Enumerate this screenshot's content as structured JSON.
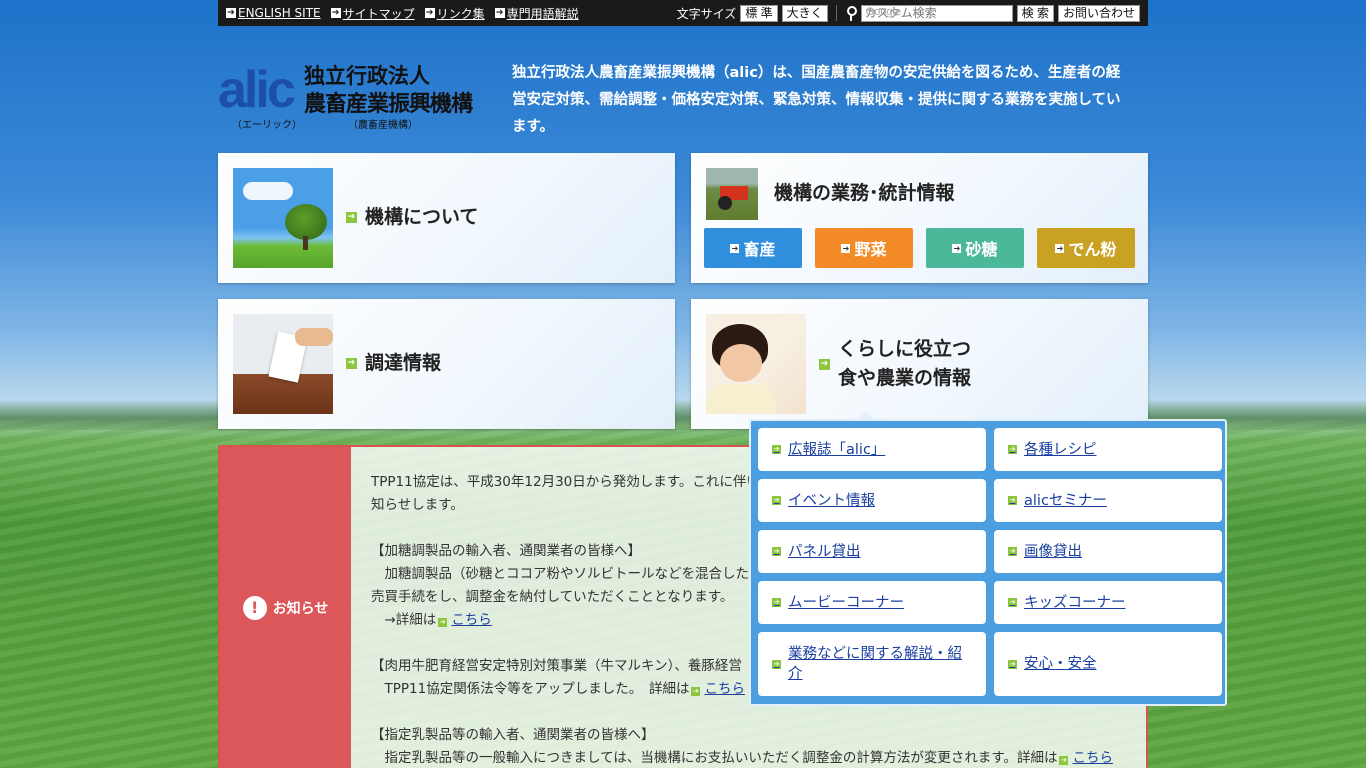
{
  "topbar": {
    "links": [
      "ENGLISH SITE",
      "サイトマップ",
      "リンク集",
      "専門用語解説"
    ],
    "font_size_label": "文字サイズ",
    "size_standard": "標 準",
    "size_large": "大きく",
    "search_placeholder": "カスタム検索",
    "search_brand": "Google",
    "search_button": "検 索",
    "contact_button": "お問い合わせ"
  },
  "header": {
    "logo_text": "alic",
    "org_name_line1": "独立行政法人",
    "org_name_line2": "農畜産業振興機構",
    "logo_reading": "（エーリック）",
    "logo_short": "（農畜産機構）",
    "intro": "独立行政法人農畜産業振興機構（alic）は、国産農畜産物の安定供給を図るため、生産者の経営安定対策、需給調整・価格安定対策、緊急対策、情報収集・提供に関する業務を実施しています。"
  },
  "tiles": {
    "about": "機構について",
    "business": "機構の業務･統計情報",
    "procurement": "調達情報",
    "life_line1": "くらしに役立つ",
    "life_line2": "食や農業の情報",
    "categories": [
      {
        "label": "畜産",
        "color": "#2f8fdc"
      },
      {
        "label": "野菜",
        "color": "#f28a28"
      },
      {
        "label": "砂糖",
        "color": "#4bb89a"
      },
      {
        "label": "でん粉",
        "color": "#c9a224"
      }
    ]
  },
  "notice": {
    "label": "お知らせ",
    "lines": [
      "TPP11協定は、平成30年12月30日から発効します。これに伴い",
      "知らせします。",
      "",
      "【加糖調製品の輸入者、通関業者の皆様へ】",
      "　加糖調製品（砂糖とココア粉やソルビトールなどを混合した",
      "売買手続をし、調整金を納付していただくこととなります。",
      "　→詳細は",
      "",
      "【肉用牛肥育経営安定特別対策事業（牛マルキン）、養豚経営",
      "　TPP11協定関係法令等をアップしました。　詳細は",
      "",
      "【指定乳製品等の輸入者、通関業者の皆様へ】",
      "　指定乳製品等の一般輸入につきましては、当機構にお支払いいただく調整金の計算方法が変更されます。詳細は"
    ],
    "link_text": "こちら"
  },
  "dropdown": {
    "items": [
      "広報誌「alic」",
      "各種レシピ",
      "イベント情報",
      "alicセミナー",
      "パネル貸出",
      "画像貸出",
      "ムービーコーナー",
      "キッズコーナー",
      "業務などに関する解説・紹介",
      "安心・安全"
    ]
  },
  "colors": {
    "top_bar": "#1a1a1a",
    "notice_red": "#dc5759",
    "dropdown_blue": "#4b9ee0",
    "link": "#1a3fa0",
    "arrow_green": "#8cc63e"
  }
}
